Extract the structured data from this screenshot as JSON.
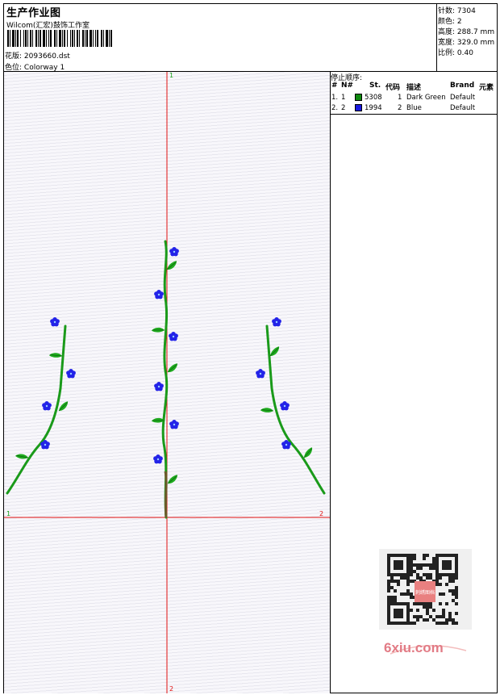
{
  "header": {
    "title": "生产作业图",
    "company": "Wilcom(汇宏)鼓饰工作室",
    "pattern_label": "花版:",
    "pattern_value": "2093660.dst",
    "colorway_label": "色位:",
    "colorway_value": "Colorway 1"
  },
  "stats": {
    "stitches_label": "针数:",
    "stitches_value": "7304",
    "colors_label": "颜色:",
    "colors_value": "2",
    "height_label": "高度:",
    "height_value": "288.7 mm",
    "width_label": "宽度:",
    "width_value": "329.0 mm",
    "scale_label": "比例:",
    "scale_value": "0.40"
  },
  "axes": {
    "top_marker": "1",
    "left_marker": "1",
    "right_marker": "2",
    "bottom_marker": "2"
  },
  "stop_sequence": {
    "title": "停止顺序:",
    "headers": {
      "hash": "#",
      "n": "N#",
      "st": "St.",
      "code": "代码",
      "desc": "描述",
      "brand": "Brand",
      "element": "元素"
    },
    "rows": [
      {
        "index": "1.",
        "n": "1",
        "st": "5308",
        "code": "1",
        "desc": "Dark Green",
        "brand": "Default",
        "color": "#0f8a0f"
      },
      {
        "index": "2.",
        "n": "2",
        "st": "1994",
        "code": "2",
        "desc": "Blue",
        "brand": "Default",
        "color": "#1a1ae0"
      }
    ]
  },
  "watermark": {
    "text": "6xiu.com",
    "qr_center": "刺绣图档"
  },
  "colors": {
    "stem": "#1a9a1a",
    "leaf": "#1faa1f",
    "flower": "#2323e8",
    "axis": "#e01010"
  }
}
